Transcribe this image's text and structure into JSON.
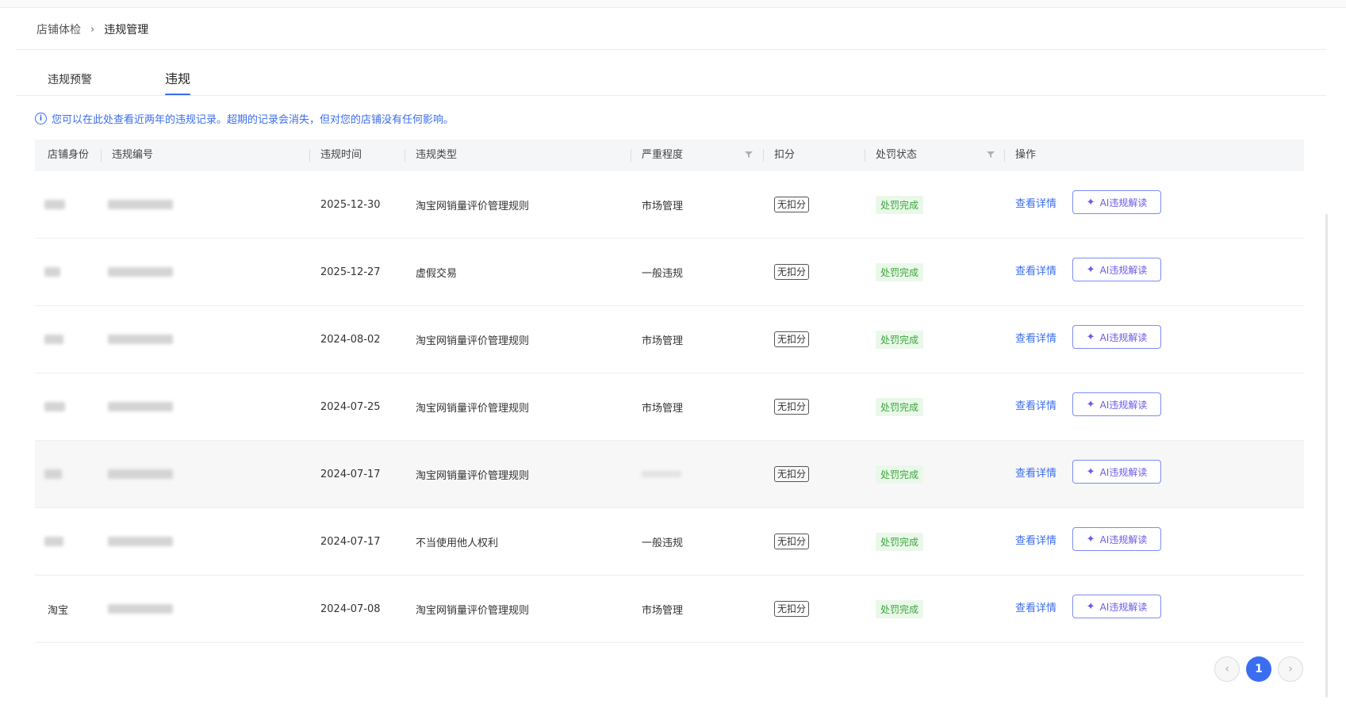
{
  "breadcrumb": {
    "parent": "店铺体检",
    "separator": "›",
    "current": "违规管理"
  },
  "tabs": [
    {
      "label": "违规预警",
      "active": false
    },
    {
      "label": "违规",
      "active": true
    }
  ],
  "notice": {
    "icon": "info-icon",
    "text": "您可以在此处查看近两年的违规记录。超期的记录会消失，但对您的店铺没有任何影响。"
  },
  "table": {
    "headers": {
      "identity": "店铺身份",
      "number": "违规编号",
      "time": "违规时间",
      "type": "违规类型",
      "severity": "严重程度",
      "deduct": "扣分",
      "status": "处罚状态",
      "action": "操作"
    },
    "rows": [
      {
        "identity": "",
        "time": "2025-12-30",
        "type": "淘宝网销量评价管理规则",
        "severity": "市场管理",
        "deduct": "无扣分",
        "status": "处罚完成",
        "detail": "查看详情",
        "ai": "AI违规解读"
      },
      {
        "identity": "",
        "time": "2025-12-27",
        "type": "虚假交易",
        "severity": "一般违规",
        "deduct": "无扣分",
        "status": "处罚完成",
        "detail": "查看详情",
        "ai": "AI违规解读"
      },
      {
        "identity": "",
        "time": "2024-08-02",
        "type": "淘宝网销量评价管理规则",
        "severity": "市场管理",
        "deduct": "无扣分",
        "status": "处罚完成",
        "detail": "查看详情",
        "ai": "AI违规解读"
      },
      {
        "identity": "",
        "time": "2024-07-25",
        "type": "淘宝网销量评价管理规则",
        "severity": "市场管理",
        "deduct": "无扣分",
        "status": "处罚完成",
        "detail": "查看详情",
        "ai": "AI违规解读"
      },
      {
        "identity": "",
        "time": "2024-07-17",
        "type": "淘宝网销量评价管理规则",
        "severity": "",
        "deduct": "无扣分",
        "status": "处罚完成",
        "detail": "查看详情",
        "ai": "AI违规解读"
      },
      {
        "identity": "",
        "time": "2024-07-17",
        "type": "不当使用他人权利",
        "severity": "一般违规",
        "deduct": "无扣分",
        "status": "处罚完成",
        "detail": "查看详情",
        "ai": "AI违规解读"
      },
      {
        "identity": "淘宝",
        "time": "2024-07-08",
        "type": "淘宝网销量评价管理规则",
        "severity": "市场管理",
        "deduct": "无扣分",
        "status": "处罚完成",
        "detail": "查看详情",
        "ai": "AI违规解读"
      }
    ]
  },
  "pagination": {
    "prev_icon": "chevron-left-icon",
    "current_page": "1",
    "next_icon": "chevron-right-icon"
  },
  "colors": {
    "accent": "#3a6df0",
    "success_bg": "#eaf8ea",
    "success_text": "#3aa53a",
    "ai_border": "#7b8cf5"
  }
}
